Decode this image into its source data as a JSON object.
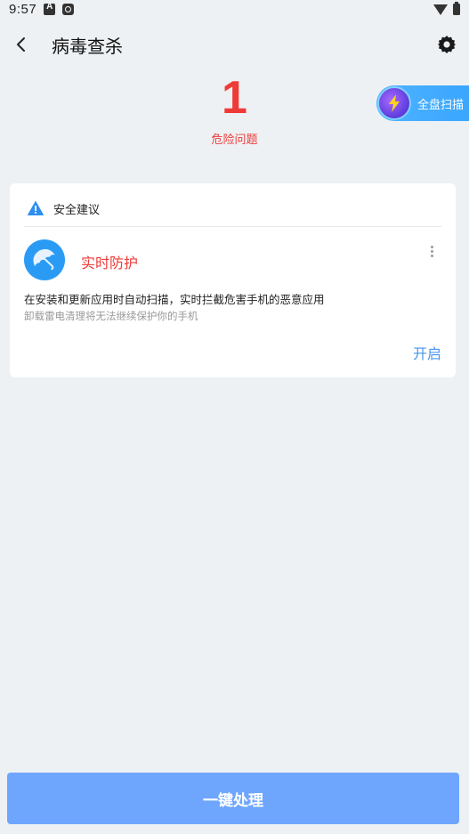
{
  "status_bar": {
    "time": "9:57"
  },
  "header": {
    "title": "病毒查杀"
  },
  "summary": {
    "count": "1",
    "label": "危险问题"
  },
  "fullscan": {
    "label": "全盘扫描"
  },
  "card": {
    "title": "安全建议",
    "item": {
      "title": "实时防护",
      "description": "在安装和更新应用时自动扫描，实时拦截危害手机的恶意应用",
      "note": "卸载雷电清理将无法继续保护你的手机",
      "action_label": "开启"
    }
  },
  "bottom": {
    "button_label": "一键处理"
  },
  "colors": {
    "danger": "#ee3b37",
    "primary_button": "#6ea6fd",
    "link": "#4a94ee",
    "background": "#edf1f4"
  },
  "icons": [
    "back-icon",
    "gear-icon",
    "lightning-icon",
    "warning-icon",
    "umbrella-icon",
    "more-icon",
    "wifi-icon",
    "battery-icon"
  ]
}
